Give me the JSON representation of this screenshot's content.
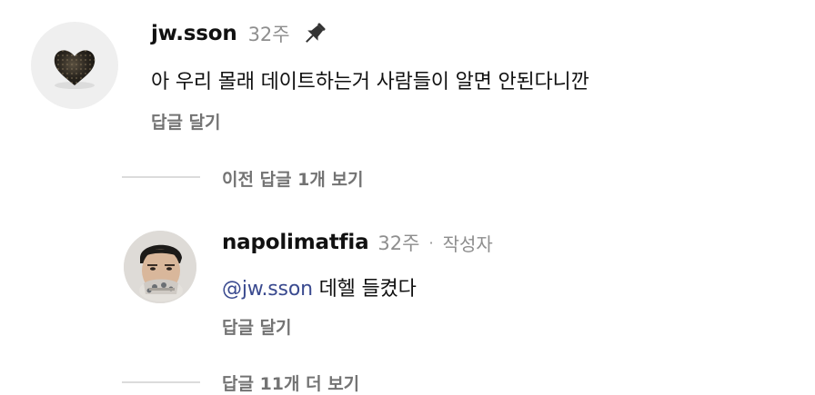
{
  "comment": {
    "username": "jw.sson",
    "time": "32주",
    "text": "아 우리 몰래 데이트하는거 사람들이 알면 안된다니깐",
    "reply_label": "답글 달기"
  },
  "view_previous": "이전 답글 1개 보기",
  "reply": {
    "username": "napolimatfia",
    "time": "32주",
    "separator": "·",
    "author_badge": "작성자",
    "mention_symbol": "@",
    "mention": "jw.sson",
    "text": "데헬 들켰다",
    "reply_label": "답글 달기"
  },
  "view_more": "답글 11개 더 보기",
  "colors": {
    "muted": "#737373",
    "time": "#8e8e8e",
    "mention": "#3a4a8f",
    "line": "#dbdbdb"
  }
}
